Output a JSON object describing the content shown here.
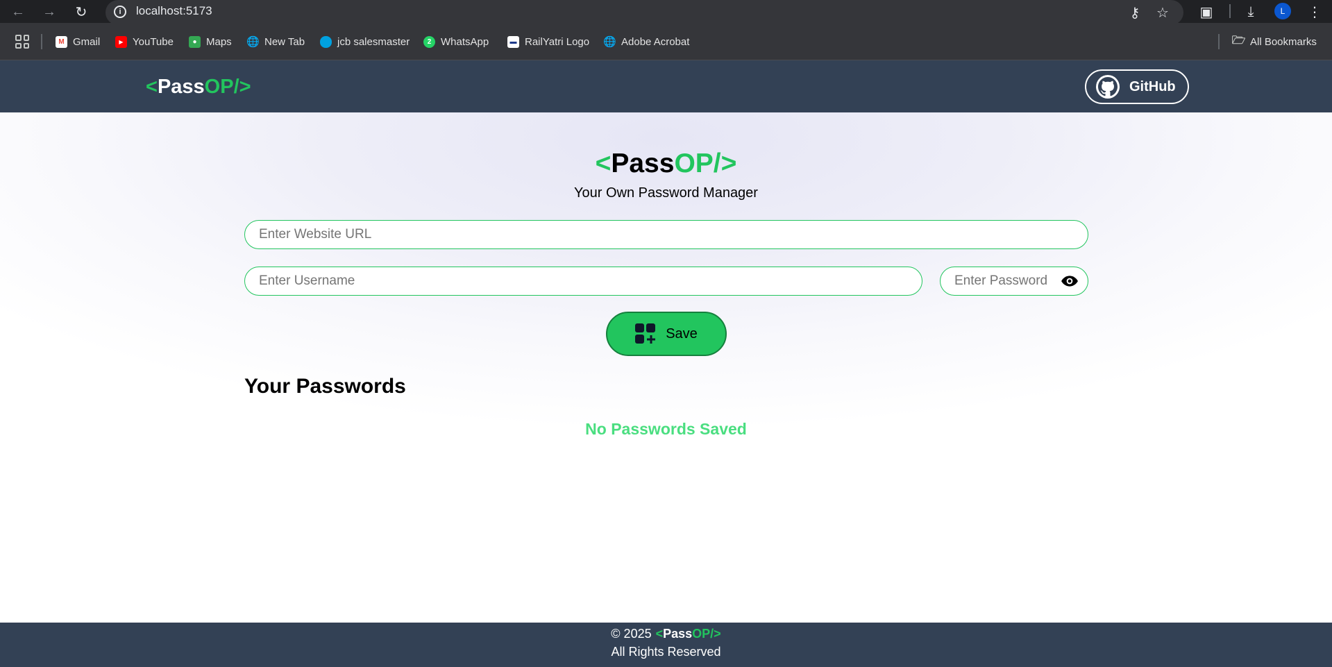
{
  "browser": {
    "url": "localhost:5173",
    "profile_initial": "L",
    "bookmarks": [
      {
        "label": "Gmail"
      },
      {
        "label": "YouTube"
      },
      {
        "label": "Maps"
      },
      {
        "label": "New Tab"
      },
      {
        "label": "jcb salesmaster"
      },
      {
        "label": "WhatsApp"
      },
      {
        "label": "RailYatri Logo"
      },
      {
        "label": "Adobe Acrobat"
      }
    ],
    "all_bookmarks": "All Bookmarks"
  },
  "logo": {
    "open": "<",
    "pass": "Pass",
    "op": "OP/>"
  },
  "nav": {
    "github_label": "GitHub"
  },
  "hero": {
    "subtitle": "Your Own Password Manager"
  },
  "form": {
    "url_placeholder": "Enter Website URL",
    "username_placeholder": "Enter Username",
    "password_placeholder": "Enter Password",
    "save_label": "Save"
  },
  "passwords": {
    "title": "Your Passwords",
    "empty_message": "No Passwords Saved"
  },
  "footer": {
    "copyright": "© 2025",
    "rights": "All Rights Reserved"
  },
  "colors": {
    "accent": "#22c55e",
    "header_bg": "#334155",
    "empty_text": "#4ade80"
  }
}
